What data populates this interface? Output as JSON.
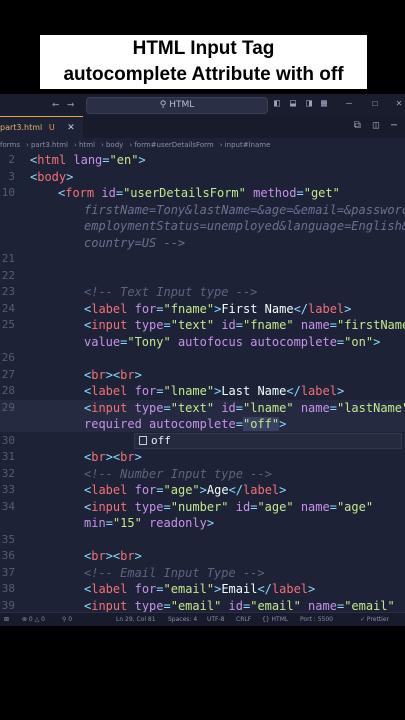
{
  "banner": {
    "line1": "HTML Input Tag",
    "line2": "autocomplete Attribute with off"
  },
  "titlebar": {
    "search_text": "HTML"
  },
  "tab": {
    "label": "part3.html",
    "modified_marker": "U"
  },
  "breadcrumb": [
    "forms",
    "part3.html",
    "html",
    "body",
    "form#userDetailsForm",
    "input#lname"
  ],
  "code_lines": [
    {
      "n": "2",
      "html": "<span class='punc'>&lt;</span><span class='tag'>html</span> <span class='attr'>lang</span><span class='punc'>=</span><span class='str'>\"en\"</span><span class='punc'>&gt;</span>",
      "indent": 0
    },
    {
      "n": "3",
      "html": "<span class='punc'>&lt;</span><span class='tag'>body</span><span class='punc'>&gt;</span>",
      "indent": 0
    },
    {
      "n": "10",
      "html": "<span class='punc'>&lt;</span><span class='tag'>form</span> <span class='attr'>id</span><span class='punc'>=</span><span class='str'>\"userDetailsForm\"</span> <span class='attr'>method</span><span class='punc'>=</span><span class='str'>\"get\"</span>",
      "indent": 1
    },
    {
      "n": "",
      "html": "<span class='faded'>firstName=Tony&amp;lastName=&amp;age=&amp;email=&amp;password=&amp;</span>",
      "indent": 2
    },
    {
      "n": "",
      "html": "<span class='faded'>employmentStatus=unemployed&amp;language=English&amp;</span>",
      "indent": 2
    },
    {
      "n": "",
      "html": "<span class='faded'>country=US --&gt;</span>",
      "indent": 2
    },
    {
      "n": "21",
      "html": "",
      "indent": 2
    },
    {
      "n": "22",
      "html": "",
      "indent": 2
    },
    {
      "n": "23",
      "html": "<span class='cmt'>&lt;!-- Text Input type --&gt;</span>",
      "indent": 2
    },
    {
      "n": "24",
      "html": "<span class='punc'>&lt;</span><span class='tag'>label</span> <span class='attr'>for</span><span class='punc'>=</span><span class='str'>\"fname\"</span><span class='punc'>&gt;</span><span class='txt'>First Name</span><span class='punc'>&lt;/</span><span class='tag'>label</span><span class='punc'>&gt;</span>",
      "indent": 2
    },
    {
      "n": "25",
      "html": "<span class='punc'>&lt;</span><span class='tag'>input</span> <span class='attr'>type</span><span class='punc'>=</span><span class='str'>\"text\"</span> <span class='attr'>id</span><span class='punc'>=</span><span class='str'>\"fname\"</span> <span class='attr'>name</span><span class='punc'>=</span><span class='str'>\"firstName\"</span>",
      "indent": 2
    },
    {
      "n": "",
      "html": "<span class='attr'>value</span><span class='punc'>=</span><span class='str'>\"Tony\"</span> <span class='attr'>autofocus</span> <span class='attr'>autocomplete</span><span class='punc'>=</span><span class='str'>\"on\"</span><span class='punc'>&gt;</span>",
      "indent": 2
    },
    {
      "n": "26",
      "html": "",
      "indent": 2
    },
    {
      "n": "27",
      "html": "<span class='punc'>&lt;</span><span class='tag'>br</span><span class='punc'>&gt;&lt;</span><span class='tag'>br</span><span class='punc'>&gt;</span>",
      "indent": 2
    },
    {
      "n": "28",
      "html": "<span class='punc'>&lt;</span><span class='tag'>label</span> <span class='attr'>for</span><span class='punc'>=</span><span class='str'>\"lname\"</span><span class='punc'>&gt;</span><span class='txt'>Last Name</span><span class='punc'>&lt;/</span><span class='tag'>label</span><span class='punc'>&gt;</span>",
      "indent": 2
    },
    {
      "n": "29",
      "html": "<span class='punc'>&lt;</span><span class='tag'>input</span> <span class='attr'>type</span><span class='punc'>=</span><span class='str'>\"text\"</span> <span class='attr'>id</span><span class='punc'>=</span><span class='str'>\"lname\"</span> <span class='attr'>name</span><span class='punc'>=</span><span class='str'>\"lastName\"</span>",
      "indent": 2,
      "current": true
    },
    {
      "n": "",
      "html": "<span class='attr'>required</span> <span class='attr'>autocomplete</span><span class='punc'>=</span><span class='str hl'>\"off\"</span><span class='punc'>&gt;</span>",
      "indent": 2,
      "current": true
    },
    {
      "n": "30",
      "html": "",
      "indent": 2,
      "suggest": true
    },
    {
      "n": "31",
      "html": "<span class='punc'>&lt;</span><span class='tag'>br</span><span class='punc'>&gt;&lt;</span><span class='tag'>br</span><span class='punc'>&gt;</span>",
      "indent": 2
    },
    {
      "n": "32",
      "html": "<span class='cmt'>&lt;!-- Number Input type --&gt;</span>",
      "indent": 2
    },
    {
      "n": "33",
      "html": "<span class='punc'>&lt;</span><span class='tag'>label</span> <span class='attr'>for</span><span class='punc'>=</span><span class='str'>\"age\"</span><span class='punc'>&gt;</span><span class='txt'>Age</span><span class='punc'>&lt;/</span><span class='tag'>label</span><span class='punc'>&gt;</span>",
      "indent": 2
    },
    {
      "n": "34",
      "html": "<span class='punc'>&lt;</span><span class='tag'>input</span> <span class='attr'>type</span><span class='punc'>=</span><span class='str'>\"number\"</span> <span class='attr'>id</span><span class='punc'>=</span><span class='str'>\"age\"</span> <span class='attr'>name</span><span class='punc'>=</span><span class='str'>\"age\"</span>",
      "indent": 2
    },
    {
      "n": "",
      "html": "<span class='attr'>min</span><span class='punc'>=</span><span class='str'>\"15\"</span> <span class='attr'>readonly</span><span class='punc'>&gt;</span>",
      "indent": 2
    },
    {
      "n": "35",
      "html": "",
      "indent": 2
    },
    {
      "n": "36",
      "html": "<span class='punc'>&lt;</span><span class='tag'>br</span><span class='punc'>&gt;&lt;</span><span class='tag'>br</span><span class='punc'>&gt;</span>",
      "indent": 2
    },
    {
      "n": "37",
      "html": "<span class='cmt'>&lt;!-- Email Input Type --&gt;</span>",
      "indent": 2
    },
    {
      "n": "38",
      "html": "<span class='punc'>&lt;</span><span class='tag'>label</span> <span class='attr'>for</span><span class='punc'>=</span><span class='str'>\"email\"</span><span class='punc'>&gt;</span><span class='txt'>Email</span><span class='punc'>&lt;/</span><span class='tag'>label</span><span class='punc'>&gt;</span>",
      "indent": 2
    },
    {
      "n": "39",
      "html": "<span class='punc'>&lt;</span><span class='tag'>input</span> <span class='attr'>type</span><span class='punc'>=</span><span class='str'>\"email\"</span> <span class='attr'>id</span><span class='punc'>=</span><span class='str'>\"email\"</span> <span class='attr'>name</span><span class='punc'>=</span><span class='str'>\"email\"</span>",
      "indent": 2
    }
  ],
  "suggestion": {
    "text": "off"
  },
  "statusbar": {
    "problems": "⊗ 0 △ 0",
    "ports": "⚲ 0",
    "position": "Ln 29, Col 81",
    "spaces": "Spaces: 4",
    "encoding": "UTF-8",
    "eol": "CRLF",
    "language": "{} HTML",
    "port": "Port : 5500",
    "prettier": "✓ Prettier"
  },
  "colors": {
    "editor_bg": "#1e2236",
    "tag": "#f07178",
    "attr": "#c792ea",
    "string": "#c3e88d",
    "tab_accent": "#e5a442"
  }
}
